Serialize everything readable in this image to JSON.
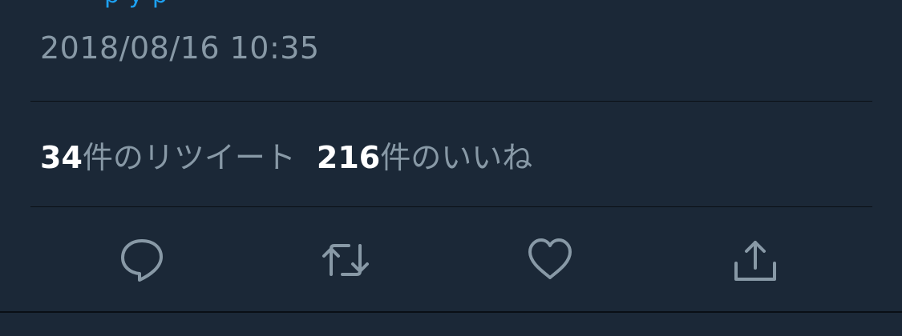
{
  "tweet": {
    "clipped_line": "p y p",
    "timestamp": "2018/08/16 10:35"
  },
  "stats": {
    "retweets_count": "34",
    "retweets_label": "件のリツイート",
    "likes_count": "216",
    "likes_label": "件のいいね"
  },
  "actions": [
    {
      "name": "reply",
      "icon": "reply-icon"
    },
    {
      "name": "retweet",
      "icon": "retweet-icon"
    },
    {
      "name": "like",
      "icon": "heart-icon"
    },
    {
      "name": "share",
      "icon": "share-icon"
    }
  ],
  "colors": {
    "background": "#1b2837",
    "secondary_text": "#8899a6",
    "primary_text": "#ffffff",
    "divider": "#0a0f15",
    "link": "#1da1f2"
  }
}
